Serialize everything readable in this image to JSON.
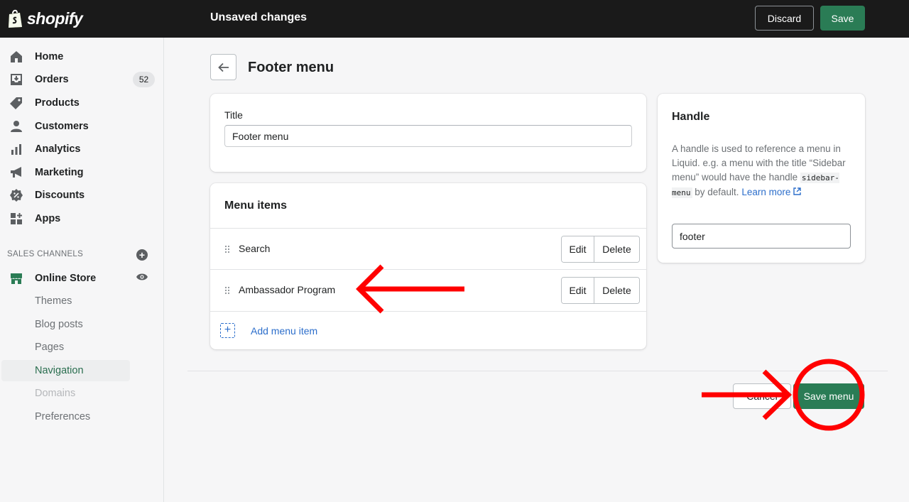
{
  "topbar": {
    "logo_text": "shopify",
    "status": "Unsaved changes",
    "discard_label": "Discard",
    "save_label": "Save"
  },
  "sidebar": {
    "items": [
      {
        "label": "Home",
        "icon": "home-icon"
      },
      {
        "label": "Orders",
        "icon": "orders-icon",
        "badge": "52"
      },
      {
        "label": "Products",
        "icon": "tag-icon"
      },
      {
        "label": "Customers",
        "icon": "person-icon"
      },
      {
        "label": "Analytics",
        "icon": "bar-chart-icon"
      },
      {
        "label": "Marketing",
        "icon": "megaphone-icon"
      },
      {
        "label": "Discounts",
        "icon": "discount-icon"
      },
      {
        "label": "Apps",
        "icon": "apps-icon"
      }
    ],
    "sales_channels_label": "SALES CHANNELS",
    "online_store_label": "Online Store",
    "sub_items": [
      "Themes",
      "Blog posts",
      "Pages",
      "Navigation",
      "Domains",
      "Preferences"
    ],
    "active_sub_item": "Navigation",
    "disabled_sub_item": "Domains"
  },
  "main": {
    "page_title": "Footer menu",
    "title_card": {
      "label": "Title",
      "value": "Footer menu"
    },
    "menu_card": {
      "heading": "Menu items",
      "rows": [
        {
          "label": "Search",
          "edit": "Edit",
          "delete": "Delete"
        },
        {
          "label": "Ambassador Program",
          "edit": "Edit",
          "delete": "Delete"
        }
      ],
      "add_label": "Add menu item"
    },
    "handle_card": {
      "heading": "Handle",
      "desc_part1": "A handle is used to reference a menu in Liquid. e.g. a menu with the title “Sidebar menu” would have the handle",
      "code": "sidebar-menu",
      "desc_part2": "by default.",
      "learn_more": "Learn more",
      "value": "footer"
    },
    "cancel_label": "Cancel",
    "save_menu_label": "Save menu"
  },
  "colors": {
    "accent_green": "#2a7c55",
    "link_blue": "#2c6ecb",
    "annotation_red": "#ff0000",
    "topbar_bg": "#1a1a1a"
  }
}
